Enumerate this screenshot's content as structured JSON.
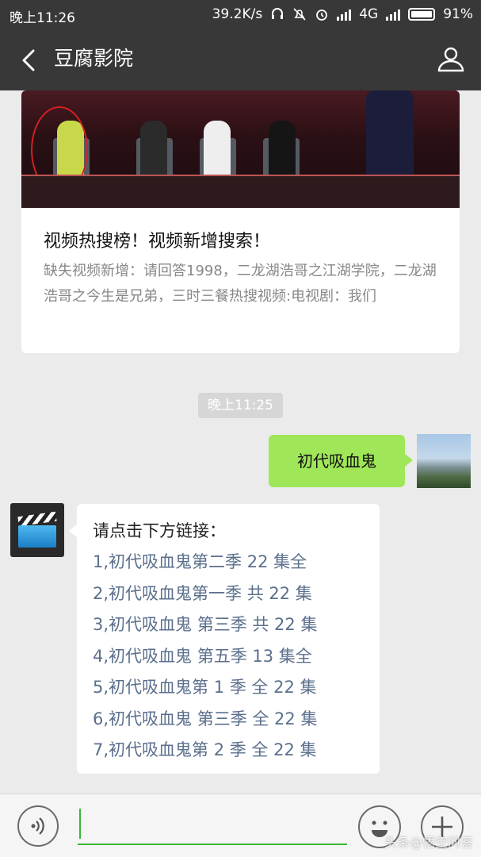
{
  "status_bar": {
    "time": "晚上11:26",
    "network_speed": "39.2K/s",
    "network_type": "4G",
    "battery": "91%",
    "icons": [
      "headset-icon",
      "alarm-icon",
      "mute-icon",
      "signal-icon",
      "battery-icon"
    ]
  },
  "header": {
    "title": "豆腐影院"
  },
  "article_card": {
    "title": "视频热搜榜！视频新增搜索！",
    "description": "缺失视频新增：请回答1998，二龙湖浩哥之江湖学院，二龙湖浩哥之今生是兄弟，三时三餐热搜视频:电视剧：我们"
  },
  "chat": {
    "timestamp": "晚上11:25",
    "sent_message": "初代吸血鬼",
    "reply_heading": "请点击下方链接：",
    "reply_links": [
      "1,初代吸血鬼第二季 22 集全",
      "2,初代吸血鬼第一季 共 22 集",
      "3,初代吸血鬼 第三季 共 22 集",
      "4,初代吸血鬼 第五季 13 集全",
      "5,初代吸血鬼第 1 季 全 22 集",
      "6,初代吸血鬼 第三季 全 22 集",
      "7,初代吸血鬼第 2 季 全 22 集"
    ]
  },
  "input_bar": {
    "value": ""
  },
  "watermark": "头条@悟空问答"
}
